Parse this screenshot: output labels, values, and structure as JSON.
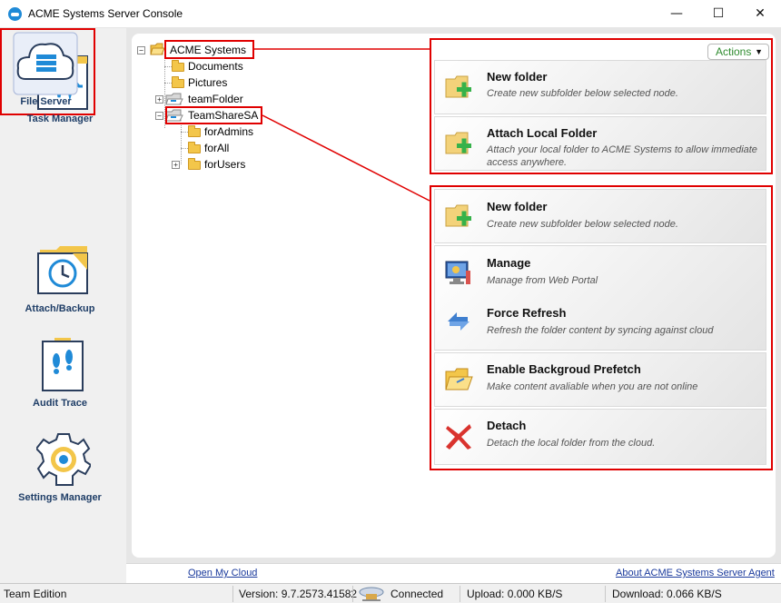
{
  "window": {
    "title": "ACME Systems Server Console",
    "minimize": "—",
    "maximize": "☐",
    "close": "✕"
  },
  "sidebar": {
    "items": [
      {
        "label": "Task Manager",
        "icon": "pulse-chart-icon"
      },
      {
        "label": "File Server",
        "icon": "server-cloud-icon",
        "selected": true
      },
      {
        "label": "Attach/Backup",
        "icon": "clock-folder-icon"
      },
      {
        "label": "Audit Trace",
        "icon": "footprints-icon"
      },
      {
        "label": "Settings Manager",
        "icon": "gear-icon"
      }
    ]
  },
  "tree": {
    "root": "ACME Systems",
    "children": [
      "Documents",
      "Pictures",
      "teamFolder",
      "TeamShareSA"
    ],
    "teamshare_children": [
      "forAdmins",
      "forAll",
      "forUsers"
    ]
  },
  "actions_button": {
    "label": "Actions",
    "arrow": "▼"
  },
  "top_panel": {
    "cards": [
      {
        "title": "New folder",
        "desc": "Create new subfolder below selected node.",
        "icon": "new-folder-icon"
      },
      {
        "title": "Attach Local Folder",
        "desc": "Attach your local folder to ACME Systems to allow immediate access anywhere.",
        "icon": "attach-folder-icon"
      }
    ]
  },
  "bottom_panel": {
    "cards": [
      {
        "title": "New folder",
        "desc": "Create new subfolder below selected node.",
        "icon": "new-folder-icon"
      },
      {
        "title": "Manage",
        "desc": "Manage from Web Portal",
        "icon": "monitor-icon"
      },
      {
        "title": "Force Refresh",
        "desc": "Refresh the folder content by syncing against cloud",
        "icon": "refresh-icon"
      },
      {
        "title": "Enable Backgroud Prefetch",
        "desc": "Make content avaliable when you are not online",
        "icon": "open-folder-icon"
      },
      {
        "title": "Detach",
        "desc": "Detach the local folder from the cloud.",
        "icon": "red-x-icon"
      }
    ]
  },
  "links": {
    "open_cloud": "Open My Cloud",
    "about": "About ACME Systems Server Agent"
  },
  "status": {
    "edition": "Team Edition",
    "version": "Version: 9.7.2573.41582",
    "connection": "Connected",
    "upload": "Upload: 0.000 KB/S",
    "download": "Download: 0.066 KB/S"
  },
  "colors": {
    "highlight": "#e00000",
    "sidebar_label": "#1f3e67",
    "link": "#1a3a9c",
    "actions_text": "#2f8c2f"
  }
}
